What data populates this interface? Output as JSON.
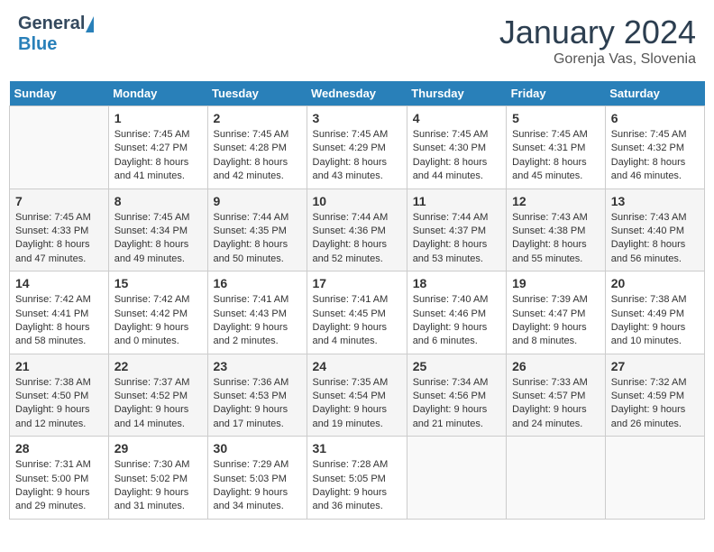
{
  "header": {
    "logo_general": "General",
    "logo_blue": "Blue",
    "month_title": "January 2024",
    "location": "Gorenja Vas, Slovenia"
  },
  "days_of_week": [
    "Sunday",
    "Monday",
    "Tuesday",
    "Wednesday",
    "Thursday",
    "Friday",
    "Saturday"
  ],
  "weeks": [
    [
      {
        "date": "",
        "info": ""
      },
      {
        "date": "1",
        "info": "Sunrise: 7:45 AM\nSunset: 4:27 PM\nDaylight: 8 hours\nand 41 minutes."
      },
      {
        "date": "2",
        "info": "Sunrise: 7:45 AM\nSunset: 4:28 PM\nDaylight: 8 hours\nand 42 minutes."
      },
      {
        "date": "3",
        "info": "Sunrise: 7:45 AM\nSunset: 4:29 PM\nDaylight: 8 hours\nand 43 minutes."
      },
      {
        "date": "4",
        "info": "Sunrise: 7:45 AM\nSunset: 4:30 PM\nDaylight: 8 hours\nand 44 minutes."
      },
      {
        "date": "5",
        "info": "Sunrise: 7:45 AM\nSunset: 4:31 PM\nDaylight: 8 hours\nand 45 minutes."
      },
      {
        "date": "6",
        "info": "Sunrise: 7:45 AM\nSunset: 4:32 PM\nDaylight: 8 hours\nand 46 minutes."
      }
    ],
    [
      {
        "date": "7",
        "info": "Sunrise: 7:45 AM\nSunset: 4:33 PM\nDaylight: 8 hours\nand 47 minutes."
      },
      {
        "date": "8",
        "info": "Sunrise: 7:45 AM\nSunset: 4:34 PM\nDaylight: 8 hours\nand 49 minutes."
      },
      {
        "date": "9",
        "info": "Sunrise: 7:44 AM\nSunset: 4:35 PM\nDaylight: 8 hours\nand 50 minutes."
      },
      {
        "date": "10",
        "info": "Sunrise: 7:44 AM\nSunset: 4:36 PM\nDaylight: 8 hours\nand 52 minutes."
      },
      {
        "date": "11",
        "info": "Sunrise: 7:44 AM\nSunset: 4:37 PM\nDaylight: 8 hours\nand 53 minutes."
      },
      {
        "date": "12",
        "info": "Sunrise: 7:43 AM\nSunset: 4:38 PM\nDaylight: 8 hours\nand 55 minutes."
      },
      {
        "date": "13",
        "info": "Sunrise: 7:43 AM\nSunset: 4:40 PM\nDaylight: 8 hours\nand 56 minutes."
      }
    ],
    [
      {
        "date": "14",
        "info": "Sunrise: 7:42 AM\nSunset: 4:41 PM\nDaylight: 8 hours\nand 58 minutes."
      },
      {
        "date": "15",
        "info": "Sunrise: 7:42 AM\nSunset: 4:42 PM\nDaylight: 9 hours\nand 0 minutes."
      },
      {
        "date": "16",
        "info": "Sunrise: 7:41 AM\nSunset: 4:43 PM\nDaylight: 9 hours\nand 2 minutes."
      },
      {
        "date": "17",
        "info": "Sunrise: 7:41 AM\nSunset: 4:45 PM\nDaylight: 9 hours\nand 4 minutes."
      },
      {
        "date": "18",
        "info": "Sunrise: 7:40 AM\nSunset: 4:46 PM\nDaylight: 9 hours\nand 6 minutes."
      },
      {
        "date": "19",
        "info": "Sunrise: 7:39 AM\nSunset: 4:47 PM\nDaylight: 9 hours\nand 8 minutes."
      },
      {
        "date": "20",
        "info": "Sunrise: 7:38 AM\nSunset: 4:49 PM\nDaylight: 9 hours\nand 10 minutes."
      }
    ],
    [
      {
        "date": "21",
        "info": "Sunrise: 7:38 AM\nSunset: 4:50 PM\nDaylight: 9 hours\nand 12 minutes."
      },
      {
        "date": "22",
        "info": "Sunrise: 7:37 AM\nSunset: 4:52 PM\nDaylight: 9 hours\nand 14 minutes."
      },
      {
        "date": "23",
        "info": "Sunrise: 7:36 AM\nSunset: 4:53 PM\nDaylight: 9 hours\nand 17 minutes."
      },
      {
        "date": "24",
        "info": "Sunrise: 7:35 AM\nSunset: 4:54 PM\nDaylight: 9 hours\nand 19 minutes."
      },
      {
        "date": "25",
        "info": "Sunrise: 7:34 AM\nSunset: 4:56 PM\nDaylight: 9 hours\nand 21 minutes."
      },
      {
        "date": "26",
        "info": "Sunrise: 7:33 AM\nSunset: 4:57 PM\nDaylight: 9 hours\nand 24 minutes."
      },
      {
        "date": "27",
        "info": "Sunrise: 7:32 AM\nSunset: 4:59 PM\nDaylight: 9 hours\nand 26 minutes."
      }
    ],
    [
      {
        "date": "28",
        "info": "Sunrise: 7:31 AM\nSunset: 5:00 PM\nDaylight: 9 hours\nand 29 minutes."
      },
      {
        "date": "29",
        "info": "Sunrise: 7:30 AM\nSunset: 5:02 PM\nDaylight: 9 hours\nand 31 minutes."
      },
      {
        "date": "30",
        "info": "Sunrise: 7:29 AM\nSunset: 5:03 PM\nDaylight: 9 hours\nand 34 minutes."
      },
      {
        "date": "31",
        "info": "Sunrise: 7:28 AM\nSunset: 5:05 PM\nDaylight: 9 hours\nand 36 minutes."
      },
      {
        "date": "",
        "info": ""
      },
      {
        "date": "",
        "info": ""
      },
      {
        "date": "",
        "info": ""
      }
    ]
  ]
}
